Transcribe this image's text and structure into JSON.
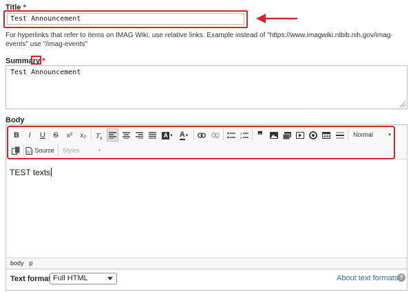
{
  "title_field": {
    "label": "Title",
    "required_mark": "*",
    "value": "Test Announcement"
  },
  "help_text": "For hyperlinks that refer to items on IMAG Wiki, use relative links. Example instead of \"https://www.imagwiki.nibib.nih.gov/imag-events\" use \"/imag-events\"",
  "summary_field": {
    "label": "Summary",
    "required_mark": "*",
    "value": "Test Announcement"
  },
  "body_field": {
    "label": "Body",
    "content": "TEST texts",
    "toolbar": {
      "bold": "B",
      "italic": "I",
      "underline": "U",
      "strike": "S",
      "superscript": "x²",
      "subscript": "x₂",
      "source_label": "Source",
      "styles_label": "Styles",
      "format_label": "Normal",
      "text_color_label": "A",
      "bg_color_label": "A",
      "blockquote": "❞"
    },
    "path": [
      "body",
      "p"
    ]
  },
  "text_format": {
    "label": "Text format",
    "selected": "Full HTML",
    "about_link": "About text formats"
  },
  "colors": {
    "highlight": "#d0272d",
    "link": "#2a6db0",
    "required": "#c8102e"
  }
}
